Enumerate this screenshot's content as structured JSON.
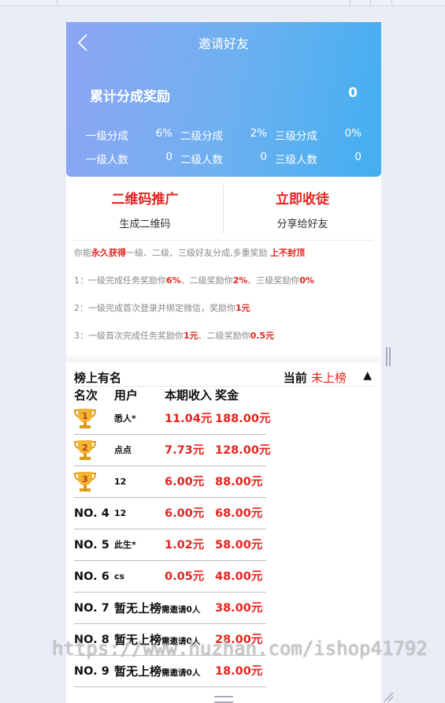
{
  "header": {
    "title": "邀请好友",
    "total_label": "累计分成奖励",
    "total_value": "0",
    "stats": [
      {
        "label": "一级分成",
        "value": "6%"
      },
      {
        "label": "二级分成",
        "value": "2%"
      },
      {
        "label": "三级分成",
        "value": "0%"
      },
      {
        "label": "一级人数",
        "value": "0"
      },
      {
        "label": "二级人数",
        "value": "0"
      },
      {
        "label": "三级人数",
        "value": "0"
      }
    ]
  },
  "promo": {
    "qr_title": "二维码推广",
    "qr_sub": "生成二维码",
    "earn_title": "立即收徒",
    "earn_sub": "分享给好友"
  },
  "info": {
    "line0": {
      "a": "你能",
      "b": "永久获得",
      "c": "一级、二级、三级好友分成,多重奖励 ",
      "d": "上不封顶"
    },
    "line1": {
      "a": "1：一级完成任务奖励你",
      "b": "6%",
      "c": "、二级奖励你",
      "d": "2%",
      "e": "、三级奖励你",
      "f": "0%"
    },
    "line2": {
      "a": "2：一级完成首次登录并绑定微信，奖励你",
      "b": "1元"
    },
    "line3": {
      "a": "3：一级首次完成任务奖励你",
      "b": "1元",
      "c": "、二级奖励你",
      "d": "0.5元"
    }
  },
  "ranking": {
    "title": "榜上有名",
    "current_label": "当前 ",
    "current_value": "未上榜",
    "toggle": "▲",
    "columns": [
      "名次",
      "用户",
      "本期收入",
      "奖金"
    ],
    "rows": [
      {
        "rank": "1",
        "user": "悉人*",
        "income": "11.04元",
        "bonus": "188.00元"
      },
      {
        "rank": "2",
        "user": "点点",
        "income": "7.73元",
        "bonus": "128.00元"
      },
      {
        "rank": "3",
        "user": "12",
        "income": "6.00元",
        "bonus": "88.00元"
      },
      {
        "rank": "NO. 4",
        "user": "12",
        "income": "6.00元",
        "bonus": "68.00元"
      },
      {
        "rank": "NO. 5",
        "user": "此生*",
        "income": "1.02元",
        "bonus": "58.00元"
      },
      {
        "rank": "NO. 6",
        "user": "cs",
        "income": "0.05元",
        "bonus": "48.00元"
      },
      {
        "rank": "NO. 7",
        "user_main": "暂无上榜",
        "user_note": "需邀请0人",
        "bonus": "38.00元"
      },
      {
        "rank": "NO. 8",
        "user_main": "暂无上榜",
        "user_note": "需邀请0人",
        "bonus": "28.00元"
      },
      {
        "rank": "NO. 9",
        "user_main": "暂无上榜",
        "user_note": "需邀请0人",
        "bonus": "18.00元"
      }
    ]
  },
  "watermark": "https://www.huzhan.com/ishop41792",
  "colors": {
    "accent_red": "#e52420",
    "header_start": "#8ea5f4",
    "header_end": "#42aff0",
    "trophy_gold": "#f2b530"
  }
}
